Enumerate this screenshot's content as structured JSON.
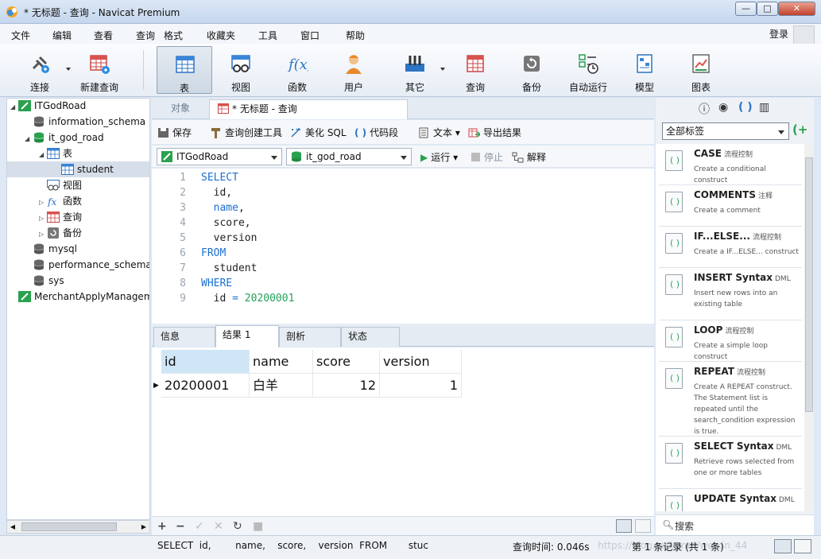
{
  "window": {
    "title": "* 无标题 - 查询 - Navicat Premium",
    "min": "—",
    "max": "□",
    "close": "✕"
  },
  "menu": [
    "文件",
    "编辑",
    "查看",
    "查询",
    "格式",
    "收藏夹",
    "工具",
    "窗口",
    "帮助"
  ],
  "login": "登录",
  "toolbar": [
    "连接",
    "新建查询",
    "表",
    "视图",
    "函数",
    "用户",
    "其它",
    "查询",
    "备份",
    "自动运行",
    "模型",
    "图表"
  ],
  "tree": [
    {
      "label": "ITGodRoad",
      "indent": 0,
      "toggle": "◢",
      "icon": "connection"
    },
    {
      "label": "information_schema",
      "indent": 1,
      "toggle": "",
      "icon": "database"
    },
    {
      "label": "it_god_road",
      "indent": 1,
      "toggle": "◢",
      "icon": "database-open"
    },
    {
      "label": "表",
      "indent": 2,
      "toggle": "◢",
      "icon": "table-folder"
    },
    {
      "label": "student",
      "indent": 3,
      "toggle": "",
      "icon": "table",
      "selected": true
    },
    {
      "label": "视图",
      "indent": 2,
      "toggle": "",
      "icon": "view"
    },
    {
      "label": "函数",
      "indent": 2,
      "toggle": "▷",
      "icon": "function"
    },
    {
      "label": "查询",
      "indent": 2,
      "toggle": "▷",
      "icon": "query"
    },
    {
      "label": "备份",
      "indent": 2,
      "toggle": "▷",
      "icon": "backup"
    },
    {
      "label": "mysql",
      "indent": 1,
      "toggle": "",
      "icon": "database"
    },
    {
      "label": "performance_schema",
      "indent": 1,
      "toggle": "",
      "icon": "database"
    },
    {
      "label": "sys",
      "indent": 1,
      "toggle": "",
      "icon": "database"
    },
    {
      "label": "MerchantApplyManagem",
      "indent": 0,
      "toggle": "",
      "icon": "connection"
    }
  ],
  "tabs": {
    "objects": "对象",
    "query": "* 无标题 - 查询"
  },
  "query_toolbar": {
    "save": "保存",
    "builder": "查询创建工具",
    "beautify": "美化 SQL",
    "snippet": "代码段",
    "text": "文本",
    "export": "导出结果"
  },
  "conn_row": {
    "connection": "ITGodRoad",
    "database": "it_god_road",
    "run": "运行",
    "stop": "停止",
    "explain": "解释"
  },
  "editor": {
    "lines": [
      [
        {
          "t": "SELECT",
          "c": "kw"
        }
      ],
      [
        {
          "t": "  id,",
          "c": ""
        }
      ],
      [
        {
          "t": "  name",
          "c": "kw"
        },
        {
          "t": ",",
          "c": ""
        }
      ],
      [
        {
          "t": "  score,",
          "c": ""
        }
      ],
      [
        {
          "t": "  version",
          "c": ""
        }
      ],
      [
        {
          "t": "FROM",
          "c": "kw"
        }
      ],
      [
        {
          "t": "  student",
          "c": ""
        }
      ],
      [
        {
          "t": "WHERE",
          "c": "kw"
        }
      ],
      [
        {
          "t": "  id ",
          "c": ""
        },
        {
          "t": "= ",
          "c": "kw"
        },
        {
          "t": "20200001",
          "c": "num"
        }
      ]
    ]
  },
  "result_tabs": [
    "信息",
    "结果 1",
    "剖析",
    "状态"
  ],
  "grid": {
    "columns": [
      "id",
      "name",
      "score",
      "version"
    ],
    "rows": [
      [
        "20200001",
        "白羊",
        "12",
        "1"
      ]
    ]
  },
  "grid_footer": [
    "+",
    "−",
    "✓",
    "✕",
    "↻",
    "■"
  ],
  "right_panel": {
    "tag_filter": "全部标签",
    "search_placeholder": "搜索",
    "snippets": [
      {
        "name": "CASE",
        "tag": "流程控制",
        "desc": "Create a conditional construct"
      },
      {
        "name": "COMMENTS",
        "tag": "注释",
        "desc": "Create a comment"
      },
      {
        "name": "IF...ELSE...",
        "tag": "流程控制",
        "desc": "Create a IF...ELSE... construct"
      },
      {
        "name": "INSERT Syntax",
        "tag": "DML",
        "desc": "Insert new rows into an existing table"
      },
      {
        "name": "LOOP",
        "tag": "流程控制",
        "desc": "Create a simple loop construct"
      },
      {
        "name": "REPEAT",
        "tag": "流程控制",
        "desc": "Create A REPEAT construct. The Statement list is repeated until the search_condition expression is true."
      },
      {
        "name": "SELECT Syntax",
        "tag": "DML",
        "desc": "Retrieve rows selected from one or more tables"
      },
      {
        "name": "UPDATE Syntax",
        "tag": "DML",
        "desc": ""
      }
    ]
  },
  "status": {
    "sql": "SELECT  id,        name,    score,    version  FROM       stuc",
    "time": "查询时间: 0.046s",
    "records": "第 1 条记录 (共 1 条)",
    "watermark": "https://blog.csdn.net/weixin_44"
  },
  "colors": {
    "keyword": "#1c6fd1",
    "number": "#24a15a",
    "selection": "#d6dfe9"
  }
}
